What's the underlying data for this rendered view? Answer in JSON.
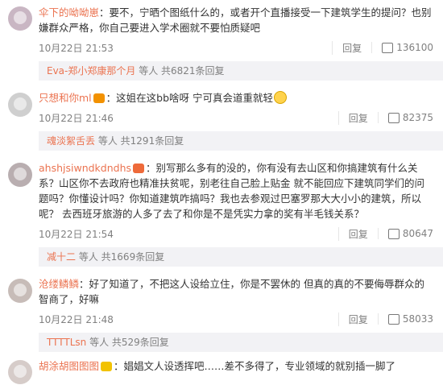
{
  "comments": [
    {
      "user": "伞下的呦呦崽",
      "text": "：要不，宁晒个图纸什么的，或者开个直播接受一下建筑学生的提问？也别嫌群众严格，你自己要进入学术圈就不要怕质疑吧",
      "time": "10月22日 21:53",
      "reply_label": "回复",
      "likes": "136100",
      "replies": {
        "name": "Eva-郑小郑康那个月",
        "summary": "等人 共6821条回复"
      }
    },
    {
      "user": "只想和你ml",
      "text": "：这姐在这bb啥呀  宁可真会道重就轻",
      "time": "10月22日 21:46",
      "reply_label": "回复",
      "likes": "82375",
      "replies": {
        "name": "魂淡絮舌丢",
        "summary": "等人 共1291条回复"
      }
    },
    {
      "user": "ahshjsiwndkdndhs",
      "text": "：别写那么多有的没的，你有没有去山区和你搞建筑有什么关系？山区你不去政府也精准扶贫呢，别老往自己脸上贴金 就不能回应下建筑同学们的问题吗？你懂设计吗？你知道建筑咋搞吗？我也去参观过巴塞罗那大大小小的建筑，所以呢？ 去西班牙旅游的人多了去了和你是不是凭实力拿的奖有半毛钱关系？",
      "time": "10月22日 21:54",
      "reply_label": "回复",
      "likes": "80647",
      "replies": {
        "name": "减十二",
        "summary": "等人 共1669条回复"
      }
    },
    {
      "user": "沧缕鳞鳞",
      "text": "：好了知道了，不把这人设给立住，你是不罢休的 但真的真的不要侮辱群众的智商了，好嘛",
      "time": "10月22日 21:48",
      "reply_label": "回复",
      "likes": "58033",
      "replies": {
        "name": "TTTTLsn",
        "summary": "等人 共529条回复"
      }
    },
    {
      "user": "胡涂胡图图图",
      "text": "：娼娼文人设透挥吧……差不多得了，专业领域的就别插一脚了"
    }
  ]
}
